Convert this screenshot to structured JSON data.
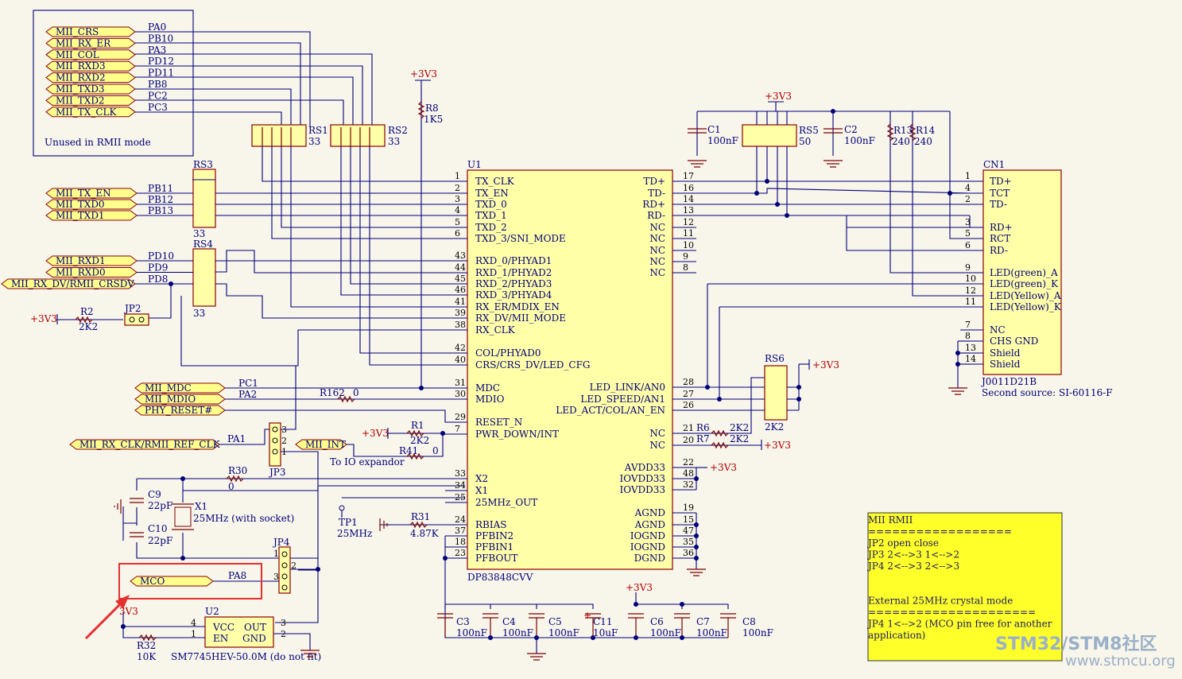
{
  "unused_box": {
    "ports": [
      "MII_CRS",
      "MII_RX_ER",
      "MII_COL",
      "MII_RXD3",
      "MII_RXD2",
      "MII_TXD3",
      "MII_TXD2",
      "MII_TX_CLK"
    ],
    "nets": [
      "PA0",
      "PB10",
      "PA3",
      "PD12",
      "PD11",
      "PB8",
      "PC2",
      "PC3"
    ],
    "caption": "Unused in RMII mode"
  },
  "tx_ports": [
    {
      "port": "MII_TX_EN",
      "net": "PB11"
    },
    {
      "port": "MII_TXD0",
      "net": "PB12"
    },
    {
      "port": "MII_TXD1",
      "net": "PB13"
    }
  ],
  "rx_ports": [
    {
      "port": "MII_RXD1",
      "net": "PD10"
    },
    {
      "port": "MII_RXD0",
      "net": "PD9"
    },
    {
      "port": "MII_RX_DV/RMII_CRSDV",
      "net": "PD8"
    }
  ],
  "mgmt_ports": [
    {
      "port": "MII_MDC",
      "net": "PC1"
    },
    {
      "port": "MII_MDIO",
      "net": "PA2"
    },
    {
      "port": "PHY_RESET#",
      "net": ""
    }
  ],
  "rxclk_port": {
    "port": "MII_RX_CLK/RMII_REF_CLK",
    "net": "PA1"
  },
  "mii_int": {
    "port": "MII_INT",
    "note": "To IO expandor"
  },
  "mco": {
    "port": "MCO",
    "net": "PA8"
  },
  "resnets": {
    "RS1": {
      "ref": "RS1",
      "val": "33"
    },
    "RS2": {
      "ref": "RS2",
      "val": "33"
    },
    "RS3": {
      "ref": "RS3",
      "val": "33"
    },
    "RS4": {
      "ref": "RS4",
      "val": "33"
    },
    "RS5": {
      "ref": "RS5",
      "val": "50"
    },
    "RS6": {
      "ref": "RS6",
      "val": "2K2"
    }
  },
  "parts": {
    "R8": {
      "ref": "R8",
      "val": "1K5"
    },
    "R2": {
      "ref": "R2",
      "val": "2K2"
    },
    "R162": {
      "ref": "R162",
      "val": "0"
    },
    "R1": {
      "ref": "R1",
      "val": "2K2"
    },
    "R41": {
      "ref": "R41",
      "val": "0"
    },
    "R30": {
      "ref": "R30",
      "val": "0"
    },
    "R31": {
      "ref": "R31",
      "val": "4.87K"
    },
    "R6": {
      "ref": "R6",
      "val": "2K2"
    },
    "R7": {
      "ref": "R7",
      "val": "2K2"
    },
    "R13": {
      "ref": "R13",
      "val": "240"
    },
    "R14": {
      "ref": "R14",
      "val": "240"
    },
    "R32": {
      "ref": "R32",
      "val": "10K"
    },
    "C1": {
      "ref": "C1",
      "val": "100nF"
    },
    "C2": {
      "ref": "C2",
      "val": "100nF"
    },
    "C3": {
      "ref": "C3",
      "val": "100nF"
    },
    "C4": {
      "ref": "C4",
      "val": "100nF"
    },
    "C5": {
      "ref": "C5",
      "val": "100nF"
    },
    "C6": {
      "ref": "C6",
      "val": "100nF"
    },
    "C7": {
      "ref": "C7",
      "val": "100nF"
    },
    "C8": {
      "ref": "C8",
      "val": "100nF"
    },
    "C9": {
      "ref": "C9",
      "val": "22pF"
    },
    "C10": {
      "ref": "C10",
      "val": "22pF"
    },
    "C11": {
      "ref": "C11",
      "val": "10uF"
    },
    "X1": {
      "ref": "X1",
      "val": "25MHz (with socket)"
    },
    "TP1": {
      "ref": "TP1",
      "val": "25MHz"
    },
    "JP2": {
      "ref": "JP2"
    },
    "JP3": {
      "ref": "JP3"
    },
    "JP4": {
      "ref": "JP4"
    },
    "U2": {
      "ref": "U2",
      "val": "SM7745HEV-50.0M (do not fit)"
    }
  },
  "power": "+3V3",
  "u1": {
    "ref": "U1",
    "part": "DP83848CVV",
    "left_pins": [
      {
        "num": "1",
        "name": "TX_CLK"
      },
      {
        "num": "2",
        "name": "TX_EN"
      },
      {
        "num": "3",
        "name": "TXD_0"
      },
      {
        "num": "4",
        "name": "TXD_1"
      },
      {
        "num": "5",
        "name": "TXD_2"
      },
      {
        "num": "6",
        "name": "TXD_3/SNI_MODE"
      },
      {
        "num": "43",
        "name": "RXD_0/PHYAD1"
      },
      {
        "num": "44",
        "name": "RXD_1/PHYAD2"
      },
      {
        "num": "45",
        "name": "RXD_2/PHYAD3"
      },
      {
        "num": "46",
        "name": "RXD_3/PHYAD4"
      },
      {
        "num": "41",
        "name": "RX_ER/MDIX_EN"
      },
      {
        "num": "39",
        "name": "RX_DV/MII_MODE"
      },
      {
        "num": "38",
        "name": "RX_CLK"
      },
      {
        "num": "42",
        "name": "COL/PHYAD0"
      },
      {
        "num": "40",
        "name": "CRS/CRS_DV/LED_CFG"
      },
      {
        "num": "31",
        "name": "MDC"
      },
      {
        "num": "30",
        "name": "MDIO"
      },
      {
        "num": "29",
        "name": "RESET_N"
      },
      {
        "num": "7",
        "name": "PWR_DOWN/INT"
      },
      {
        "num": "33",
        "name": "X2"
      },
      {
        "num": "34",
        "name": "X1"
      },
      {
        "num": "25",
        "name": "25MHz_OUT"
      },
      {
        "num": "24",
        "name": "RBIAS"
      },
      {
        "num": "37",
        "name": "PFBIN2"
      },
      {
        "num": "18",
        "name": "PFBIN1"
      },
      {
        "num": "23",
        "name": "PFBOUT"
      }
    ],
    "right_pins": [
      {
        "num": "17",
        "name": "TD+"
      },
      {
        "num": "16",
        "name": "TD-"
      },
      {
        "num": "14",
        "name": "RD+"
      },
      {
        "num": "13",
        "name": "RD-"
      },
      {
        "num": "12",
        "name": "NC"
      },
      {
        "num": "11",
        "name": "NC"
      },
      {
        "num": "10",
        "name": "NC"
      },
      {
        "num": "9",
        "name": "NC"
      },
      {
        "num": "8",
        "name": "NC"
      },
      {
        "num": "28",
        "name": "LED_LINK/AN0"
      },
      {
        "num": "27",
        "name": "LED_SPEED/AN1"
      },
      {
        "num": "26",
        "name": "LED_ACT/COL/AN_EN"
      },
      {
        "num": "21",
        "name": "NC"
      },
      {
        "num": "20",
        "name": "NC"
      },
      {
        "num": "22",
        "name": "AVDD33"
      },
      {
        "num": "48",
        "name": "IOVDD33"
      },
      {
        "num": "32",
        "name": "IOVDD33"
      },
      {
        "num": "19",
        "name": "AGND"
      },
      {
        "num": "15",
        "name": "AGND"
      },
      {
        "num": "47",
        "name": "IOGND"
      },
      {
        "num": "35",
        "name": "IOGND"
      },
      {
        "num": "36",
        "name": "DGND"
      }
    ]
  },
  "cn1": {
    "ref": "CN1",
    "part": "J0011D21B",
    "second_source": "Second source: SI-60116-F",
    "pins": [
      {
        "num": "1",
        "name": "TD+"
      },
      {
        "num": "4",
        "name": "TCT"
      },
      {
        "num": "2",
        "name": "TD-"
      },
      {
        "num": "3",
        "name": "RD+"
      },
      {
        "num": "5",
        "name": "RCT"
      },
      {
        "num": "6",
        "name": "RD-"
      },
      {
        "num": "9",
        "name": "LED(green)_A"
      },
      {
        "num": "10",
        "name": "LED(green)_K"
      },
      {
        "num": "12",
        "name": "LED(Yellow)_A"
      },
      {
        "num": "11",
        "name": "LED(Yellow)_K"
      },
      {
        "num": "7",
        "name": "NC"
      },
      {
        "num": "8",
        "name": "CHS GND"
      },
      {
        "num": "13",
        "name": "Shield"
      },
      {
        "num": "14",
        "name": "Shield"
      }
    ]
  },
  "u2": {
    "pins": [
      {
        "num": "4",
        "name": "VCC"
      },
      {
        "num": "1",
        "name": "EN"
      },
      {
        "num": "3",
        "name": "OUT"
      },
      {
        "num": "2",
        "name": "GND"
      }
    ]
  },
  "note": {
    "lines": [
      "MII         RMII",
      "==================",
      "JP2     open        close",
      "JP3     2<-->3       1<-->2",
      "JP4     2<-->3       2<-->3",
      "",
      "",
      "External 25MHz crystal mode",
      "=====================",
      "JP4    1<-->2 (MCO pin free for another",
      "application)"
    ]
  },
  "watermark": {
    "line1": "STM32/STM8社区",
    "line2": "www.stmcu.org"
  },
  "colors": {
    "background": "#f8f5ea",
    "wire": "#00007a",
    "component_fill": "#ffffa8",
    "note_fill": "#ffff2a",
    "highlight": "#e53030"
  }
}
